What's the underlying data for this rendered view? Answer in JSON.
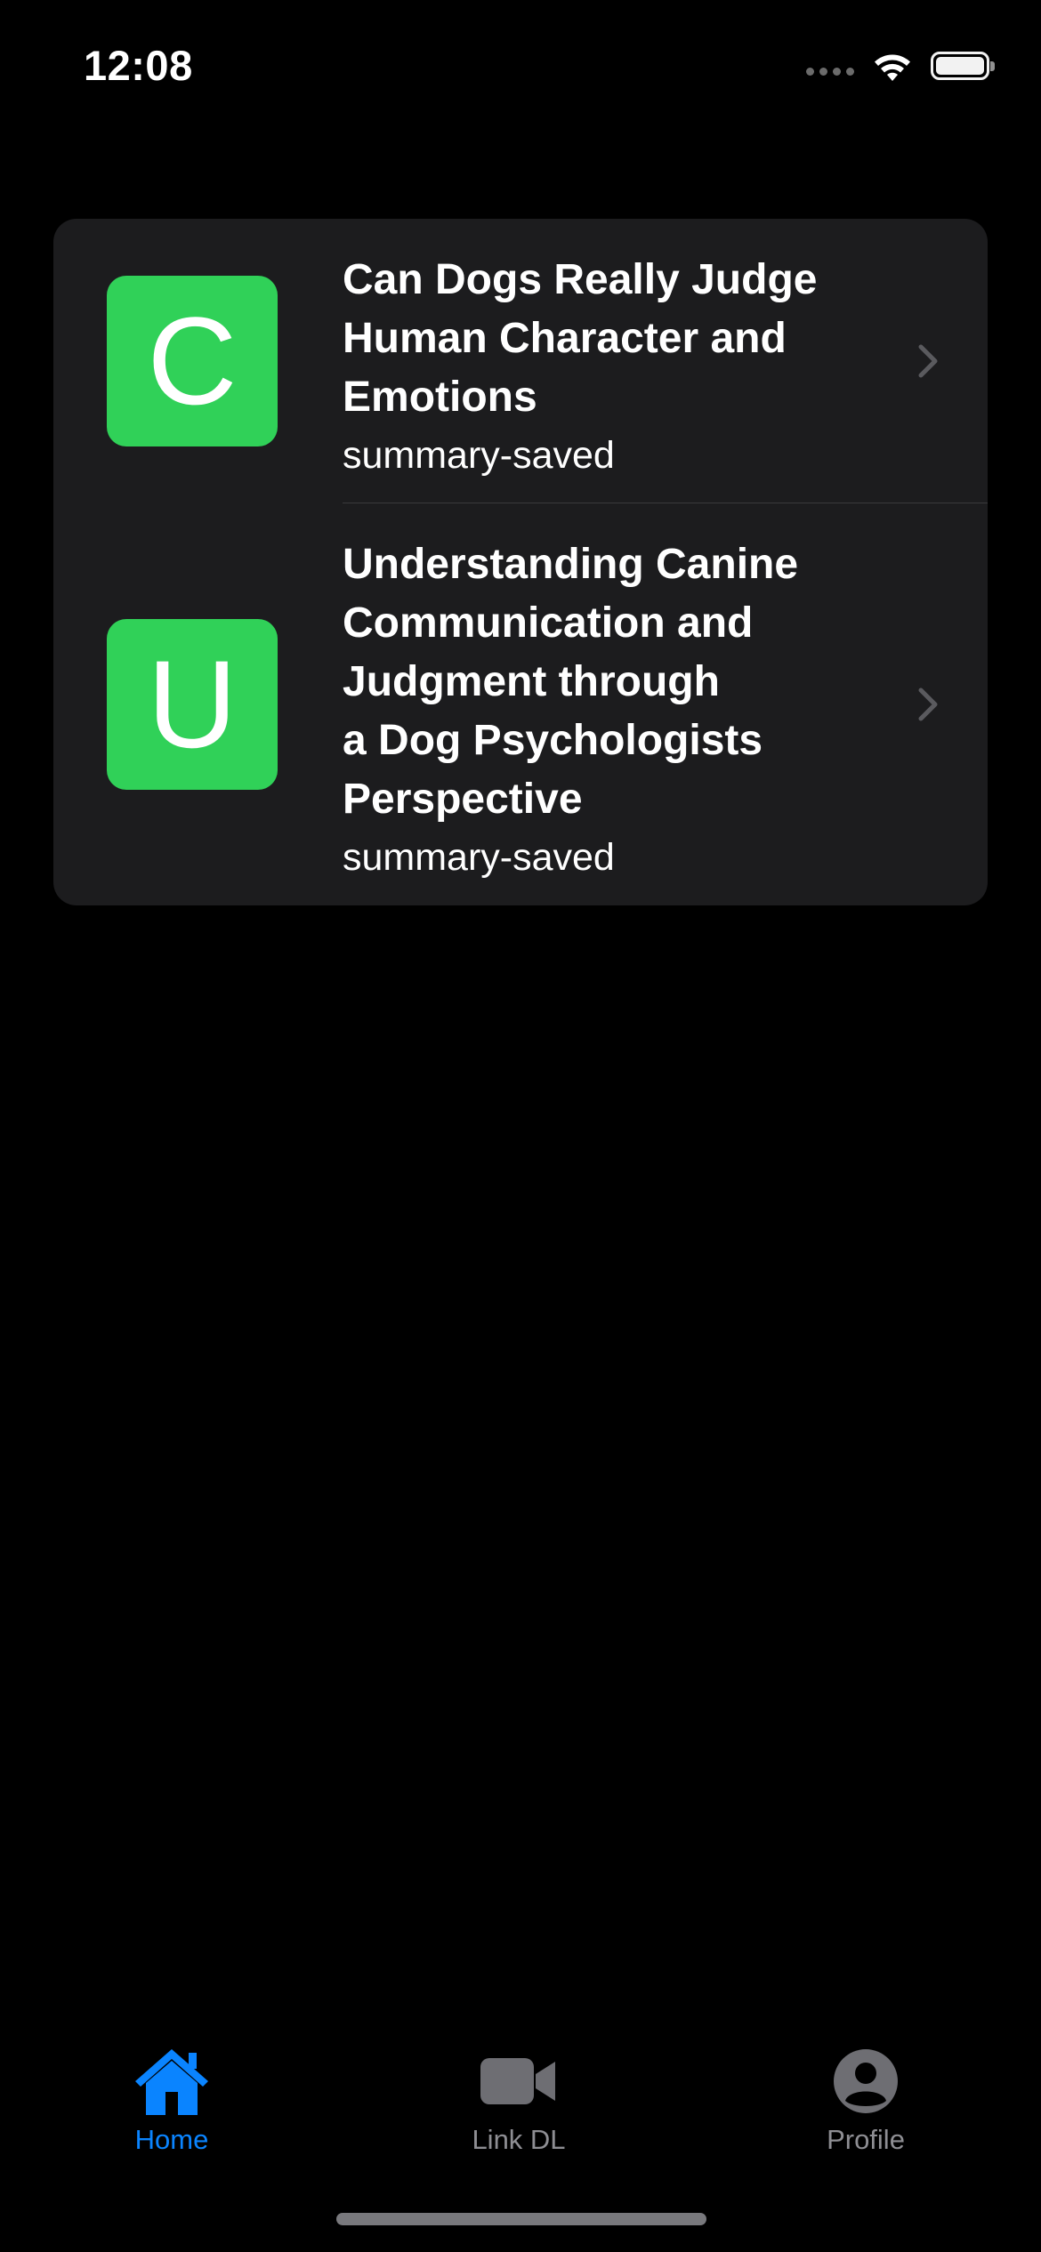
{
  "status_bar": {
    "time": "12:08"
  },
  "colors": {
    "background": "#000000",
    "card": "#1c1c1e",
    "avatar_green": "#30d158",
    "accent_blue": "#0a84ff",
    "inactive_gray": "#8e8e93"
  },
  "list": {
    "items": [
      {
        "avatar_letter": "C",
        "title_lines": [
          "Can Dogs Really Judge",
          "Human Character and",
          "Emotions"
        ],
        "subtitle": "summary-saved"
      },
      {
        "avatar_letter": "U",
        "title_lines": [
          "Understanding Canine",
          "Communication and",
          "Judgment through",
          "a Dog Psychologists",
          "Perspective"
        ],
        "subtitle": "summary-saved"
      }
    ]
  },
  "tab_bar": {
    "tabs": [
      {
        "label": "Home",
        "icon": "house-icon",
        "selected": true
      },
      {
        "label": "Link DL",
        "icon": "video-camera-icon",
        "selected": false
      },
      {
        "label": "Profile",
        "icon": "person-circle-icon",
        "selected": false
      }
    ]
  }
}
